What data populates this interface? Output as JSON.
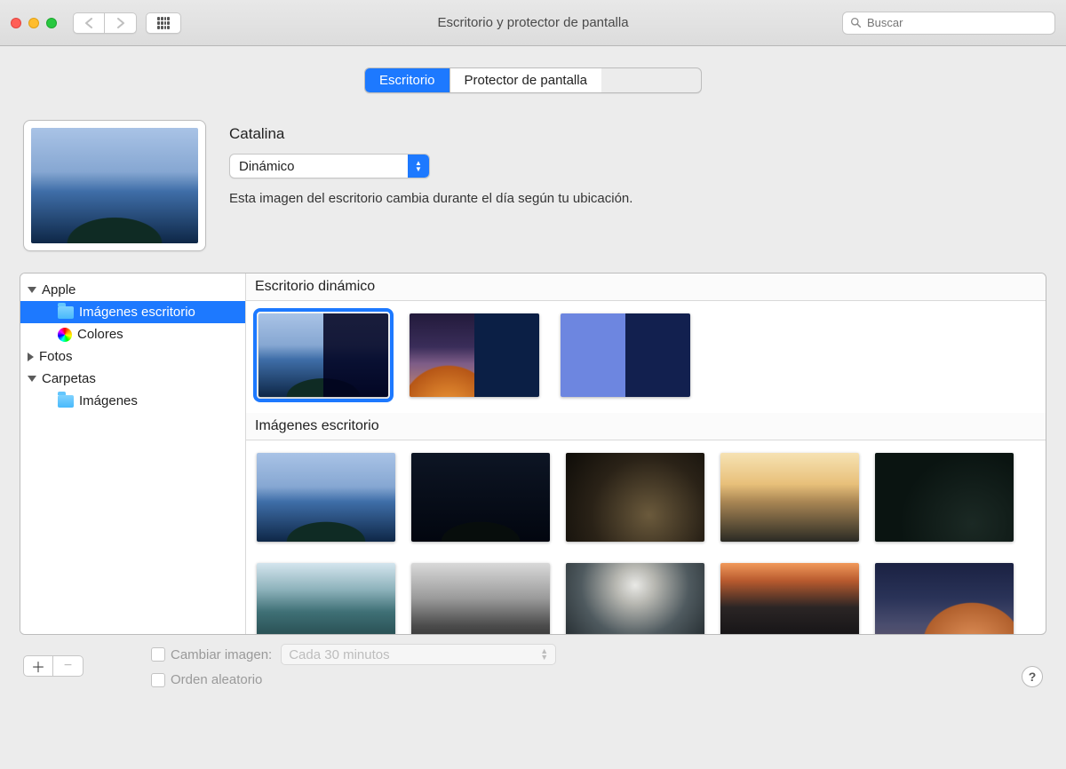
{
  "window": {
    "title": "Escritorio y protector de pantalla",
    "search_placeholder": "Buscar"
  },
  "tabs": {
    "desktop": "Escritorio",
    "screensaver": "Protector de pantalla"
  },
  "current": {
    "name": "Catalina",
    "mode_selected": "Dinámico",
    "description": "Esta imagen del escritorio cambia durante el día según tu ubicación."
  },
  "sidebar": {
    "apple": "Apple",
    "desktop_pictures": "Imágenes escritorio",
    "colors": "Colores",
    "photos": "Fotos",
    "folders": "Carpetas",
    "images": "Imágenes"
  },
  "sections": {
    "dynamic": "Escritorio dinámico",
    "wallpapers": "Imágenes escritorio"
  },
  "bottom": {
    "change_picture": "Cambiar imagen:",
    "interval_selected": "Cada 30 minutos",
    "random": "Orden aleatorio"
  },
  "icons": {
    "help": "?"
  }
}
